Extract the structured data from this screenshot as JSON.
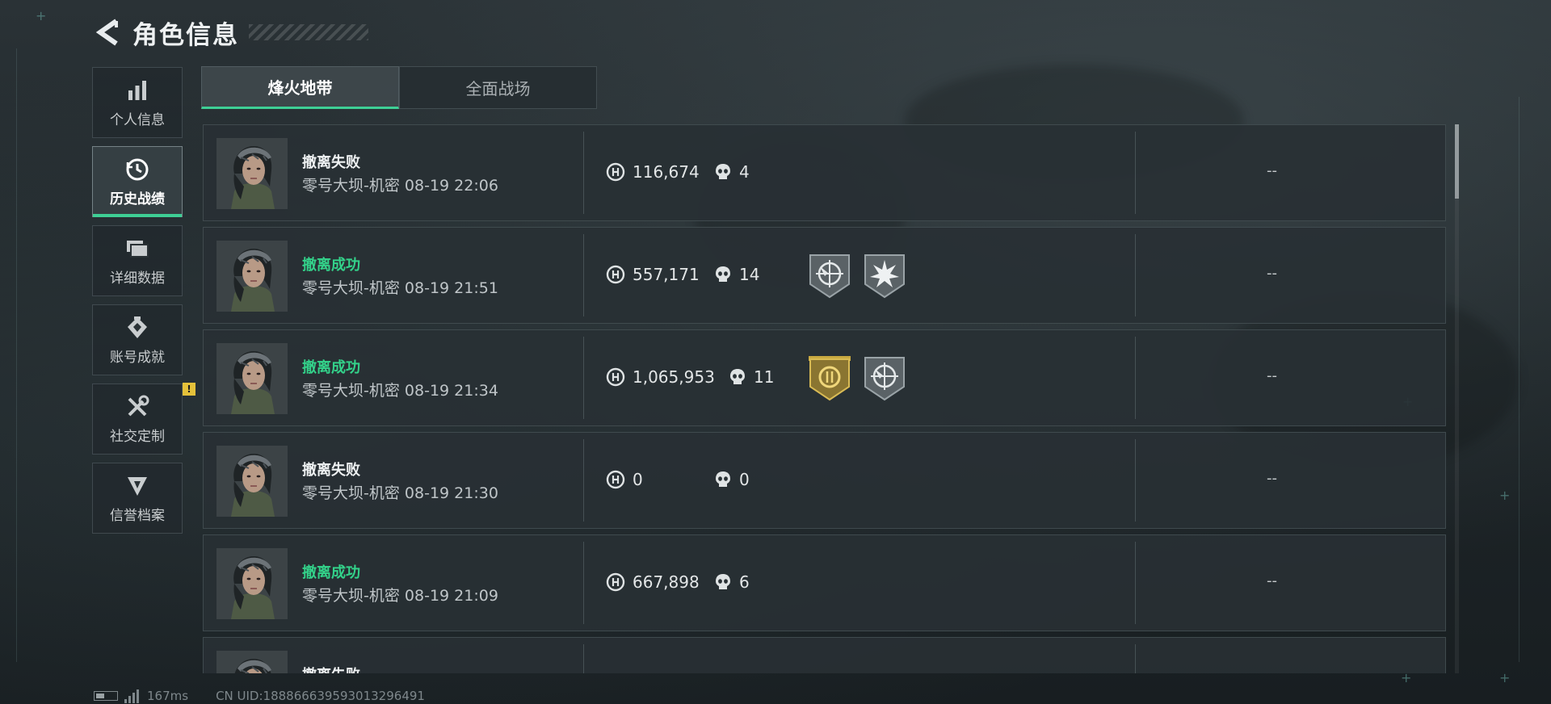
{
  "header": {
    "title": "角色信息"
  },
  "sidebar": {
    "items": [
      {
        "label": "个人信息",
        "icon": "bar-chart-icon",
        "active": false
      },
      {
        "label": "历史战绩",
        "icon": "history-clock-icon",
        "active": true
      },
      {
        "label": "详细数据",
        "icon": "folder-icon",
        "active": false
      },
      {
        "label": "账号成就",
        "icon": "achievement-icon",
        "active": false
      },
      {
        "label": "社交定制",
        "icon": "tools-icon",
        "active": false,
        "badge": "!"
      },
      {
        "label": "信誉档案",
        "icon": "credit-icon",
        "active": false
      }
    ]
  },
  "tabs": [
    {
      "label": "烽火地带",
      "active": true
    },
    {
      "label": "全面战场",
      "active": false
    }
  ],
  "matches": [
    {
      "outcome": "撤离失败",
      "success": false,
      "map": "零号大坝-机密",
      "time": "08-19 22:06",
      "value": "116,674",
      "kills": "4",
      "medals": [],
      "extra": "--"
    },
    {
      "outcome": "撤离成功",
      "success": true,
      "map": "零号大坝-机密",
      "time": "08-19 21:51",
      "value": "557,171",
      "kills": "14",
      "medals": [
        "crosshair-medal-icon",
        "burst-medal-icon"
      ],
      "extra": "--"
    },
    {
      "outcome": "撤离成功",
      "success": true,
      "map": "零号大坝-机密",
      "time": "08-19 21:34",
      "value": "1,065,953",
      "kills": "11",
      "medals": [
        "gold-coin-medal-icon",
        "crosshair-medal-icon"
      ],
      "extra": "--"
    },
    {
      "outcome": "撤离失败",
      "success": false,
      "map": "零号大坝-机密",
      "time": "08-19 21:30",
      "value": "0",
      "kills": "0",
      "medals": [],
      "extra": "--"
    },
    {
      "outcome": "撤离成功",
      "success": true,
      "map": "零号大坝-机密",
      "time": "08-19 21:09",
      "value": "667,898",
      "kills": "6",
      "medals": [],
      "extra": "--"
    },
    {
      "outcome": "撤离失败",
      "success": false,
      "map": "",
      "time": "",
      "value": "",
      "kills": "",
      "medals": [],
      "extra": ""
    }
  ],
  "footer": {
    "ping": "167ms",
    "uid": "CN UID:188866639593013296491"
  },
  "colors": {
    "accent": "#3ecf95",
    "success": "#33d28a",
    "badge": "#e5c13a"
  }
}
